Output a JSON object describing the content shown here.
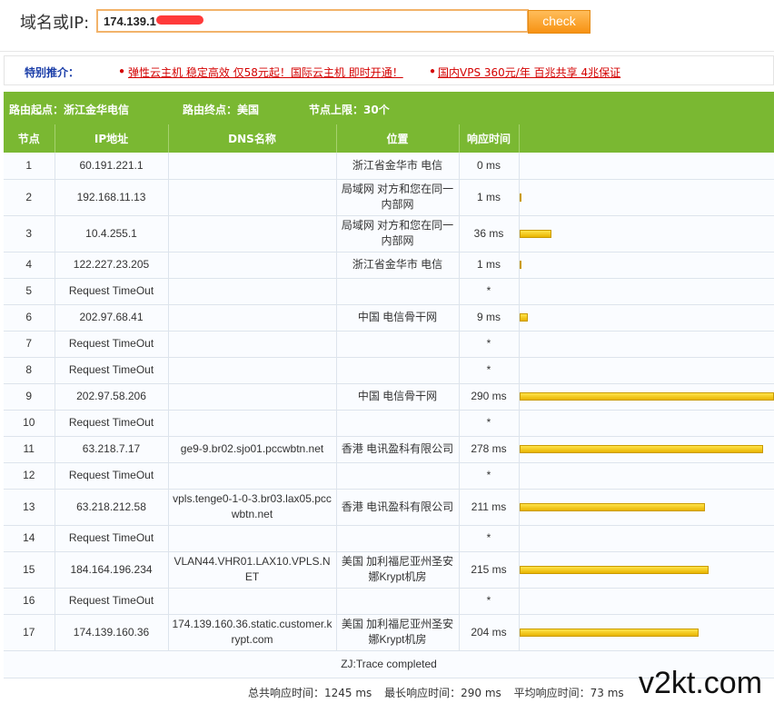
{
  "query": {
    "label": "域名或IP:",
    "value": "174.139.1",
    "button": "check"
  },
  "promo": {
    "label": "特别推介：",
    "links": [
      "弹性云主机 稳定高效 仅58元起！国际云主机 即时开通！",
      "国内VPS 360元/年 百兆共享 4兆保证"
    ]
  },
  "route": {
    "start": "路由起点：浙江金华电信",
    "end": "路由终点：美国",
    "limit": "节点上限：30个"
  },
  "table": {
    "headers": [
      "节点",
      "IP地址",
      "DNS名称",
      "位置",
      "响应时间",
      ""
    ],
    "rows": [
      {
        "hop": "1",
        "ip": "60.191.221.1",
        "dns": "",
        "loc": "浙江省金华市 电信",
        "time": "0 ms",
        "ms": 0
      },
      {
        "hop": "2",
        "ip": "192.168.11.13",
        "dns": "",
        "loc": "局域网 对方和您在同一内部网",
        "time": "1 ms",
        "ms": 1
      },
      {
        "hop": "3",
        "ip": "10.4.255.1",
        "dns": "",
        "loc": "局域网 对方和您在同一内部网",
        "time": "36 ms",
        "ms": 36
      },
      {
        "hop": "4",
        "ip": "122.227.23.205",
        "dns": "",
        "loc": "浙江省金华市 电信",
        "time": "1 ms",
        "ms": 1
      },
      {
        "hop": "5",
        "ip": "Request TimeOut",
        "dns": "",
        "loc": "",
        "time": "*",
        "ms": 0
      },
      {
        "hop": "6",
        "ip": "202.97.68.41",
        "dns": "",
        "loc": "中国 电信骨干网",
        "time": "9 ms",
        "ms": 9
      },
      {
        "hop": "7",
        "ip": "Request TimeOut",
        "dns": "",
        "loc": "",
        "time": "*",
        "ms": 0
      },
      {
        "hop": "8",
        "ip": "Request TimeOut",
        "dns": "",
        "loc": "",
        "time": "*",
        "ms": 0
      },
      {
        "hop": "9",
        "ip": "202.97.58.206",
        "dns": "",
        "loc": "中国 电信骨干网",
        "time": "290 ms",
        "ms": 290
      },
      {
        "hop": "10",
        "ip": "Request TimeOut",
        "dns": "",
        "loc": "",
        "time": "*",
        "ms": 0
      },
      {
        "hop": "11",
        "ip": "63.218.7.17",
        "dns": "ge9-9.br02.sjo01.pccwbtn.net",
        "loc": "香港 电讯盈科有限公司",
        "time": "278 ms",
        "ms": 278
      },
      {
        "hop": "12",
        "ip": "Request TimeOut",
        "dns": "",
        "loc": "",
        "time": "*",
        "ms": 0
      },
      {
        "hop": "13",
        "ip": "63.218.212.58",
        "dns": "vpls.tenge0-1-0-3.br03.lax05.pccwbtn.net",
        "loc": "香港 电讯盈科有限公司",
        "time": "211 ms",
        "ms": 211
      },
      {
        "hop": "14",
        "ip": "Request TimeOut",
        "dns": "",
        "loc": "",
        "time": "*",
        "ms": 0
      },
      {
        "hop": "15",
        "ip": "184.164.196.234",
        "dns": "VLAN44.VHR01.LAX10.VPLS.NET",
        "loc": "美国 加利福尼亚州圣安娜Krypt机房",
        "time": "215 ms",
        "ms": 215
      },
      {
        "hop": "16",
        "ip": "Request TimeOut",
        "dns": "",
        "loc": "",
        "time": "*",
        "ms": 0
      },
      {
        "hop": "17",
        "ip": "174.139.160.36",
        "dns": "174.139.160.36.static.customer.krypt.com",
        "loc": "美国 加利福尼亚州圣安娜Krypt机房",
        "time": "204 ms",
        "ms": 204
      }
    ]
  },
  "status": "ZJ:Trace completed",
  "summary": {
    "total": "总共响应时间：1245 ms",
    "max": "最长响应时间：290 ms",
    "avg": "平均响应时间：73 ms"
  },
  "watermark": "v2kt.com",
  "colors": {
    "header_green": "#7ab832",
    "bar_yellow": "#f2c200",
    "link_red": "#d40000",
    "button_orange": "#f79213"
  }
}
